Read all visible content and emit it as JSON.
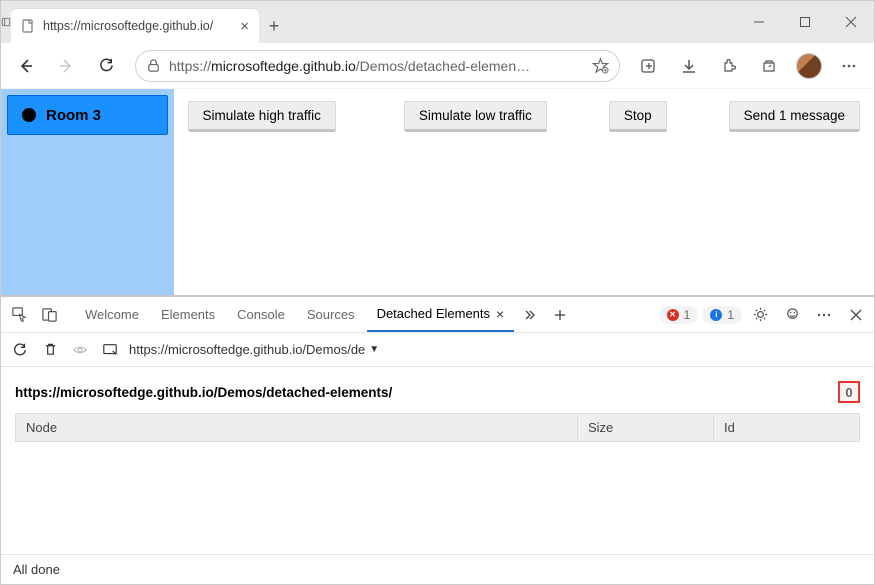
{
  "titlebar": {
    "tab_title": "https://microsoftedge.github.io/",
    "minimize": "—",
    "maximize": "▢",
    "close": "✕",
    "newtab": "+"
  },
  "toolbar": {
    "url_prefix": "https://",
    "url_host": "microsoftedge.github.io",
    "url_path": "/Demos/detached-elemen…"
  },
  "page": {
    "room_label": "Room 3",
    "buttons": {
      "high": "Simulate high traffic",
      "low": "Simulate low traffic",
      "stop": "Stop",
      "send": "Send 1 message"
    }
  },
  "devtools": {
    "tabs": {
      "welcome": "Welcome",
      "elements": "Elements",
      "console": "Console",
      "sources": "Sources",
      "detached": "Detached Elements"
    },
    "errors": "1",
    "infos": "1",
    "frame_dropdown": "https://microsoftedge.github.io/Demos/de",
    "page_url": "https://microsoftedge.github.io/Demos/detached-elements/",
    "count_badge": "0",
    "columns": {
      "node": "Node",
      "size": "Size",
      "id": "Id"
    },
    "status": "All done"
  }
}
